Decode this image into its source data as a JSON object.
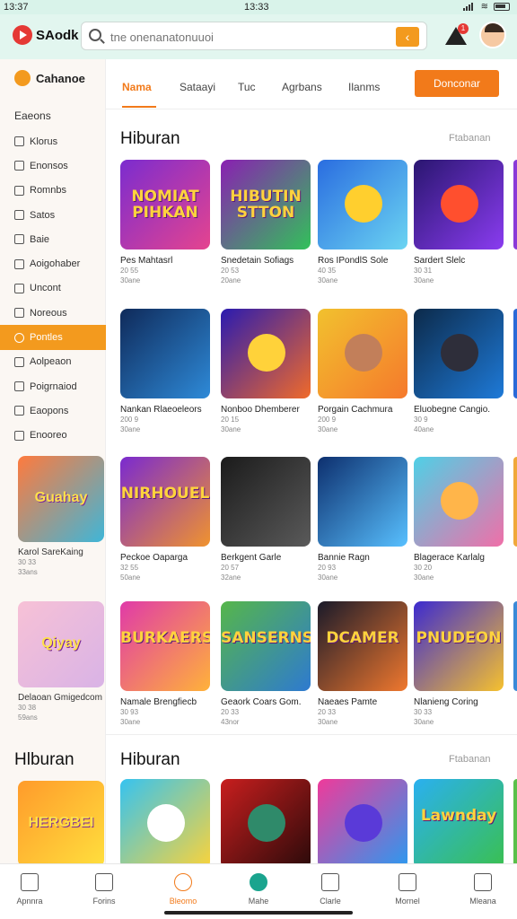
{
  "status": {
    "left_time": "13:37",
    "center_time": "13:33"
  },
  "header": {
    "brand": "SAodk",
    "search_placeholder": "tne onenanatonuuoi",
    "notification_count": "1"
  },
  "sidebar": {
    "brand": "Cahanoe",
    "heading": "Eaeons",
    "items": [
      {
        "label": "Klorus",
        "icon": "pencil-icon"
      },
      {
        "label": "Enonsos",
        "icon": "square-icon"
      },
      {
        "label": "Romnbs",
        "icon": "edit-icon"
      },
      {
        "label": "Satos",
        "icon": "edit-icon"
      },
      {
        "label": "Baie",
        "icon": "document-icon"
      },
      {
        "label": "Aoigohaber",
        "icon": "search-icon"
      },
      {
        "label": "Uncont",
        "icon": "document-icon"
      },
      {
        "label": "Noreous",
        "icon": "document-icon"
      },
      {
        "label": "Pontles",
        "icon": "heart-icon",
        "active": true
      },
      {
        "label": "Aolpeaon",
        "icon": "bulb-icon"
      },
      {
        "label": "Poigrnaiod",
        "icon": "edit-icon"
      },
      {
        "label": "Eaopons",
        "icon": "chart-icon"
      },
      {
        "label": "Enooreo",
        "icon": "grid-icon"
      }
    ],
    "cards": [
      {
        "name": "Karol SareKaing",
        "meta1": "30 33",
        "meta2": "33ans",
        "colors": [
          "#ff7a3d",
          "#3fb6d8"
        ],
        "text": "Guahay"
      },
      {
        "name": "Delaoan Gmigedcom",
        "meta1": "30 38",
        "meta2": "59ans",
        "colors": [
          "#f7c1d6",
          "#d9b3e6"
        ],
        "text": "Qiyay"
      },
      {
        "name": "",
        "meta1": "",
        "meta2": "",
        "colors": [
          "#ff9b2b",
          "#ffdf3d"
        ],
        "text": "HERGBEI"
      }
    ],
    "section_title": "Hlburan"
  },
  "tabs": [
    "Nama",
    "Sataayi",
    "Tuc",
    "Agrbans",
    "Ilanms"
  ],
  "cta": "Donconar",
  "section1": {
    "title": "Hiburan",
    "link": "Ftabanan"
  },
  "section2": {
    "title": "Hiburan",
    "link": "Ftabanan"
  },
  "games": [
    {
      "name": "Pes Mahtasrl",
      "meta1": "20 55",
      "meta2": "30ane",
      "text": "NOMIAT PIHKAN",
      "colors": [
        "#7b2ccf",
        "#e5448f"
      ],
      "face": ""
    },
    {
      "name": "Snedetain Sofiags",
      "meta1": "20 53",
      "meta2": "20ane",
      "text": "HIBUTIN STTON",
      "colors": [
        "#8a1fb2",
        "#32c15a"
      ],
      "face": ""
    },
    {
      "name": "Ros IPondlS Sole",
      "meta1": "40 35",
      "meta2": "30ane",
      "text": "",
      "colors": [
        "#2a6de0",
        "#6bd4f2"
      ],
      "face": "#ffcf2e"
    },
    {
      "name": "Sardert Slelc",
      "meta1": "30 31",
      "meta2": "30ane",
      "text": "",
      "colors": [
        "#2a1670",
        "#8a3cf0"
      ],
      "face": "#ff4f2e"
    },
    {
      "name": "Nankan Rlaeoeleors",
      "meta1": "200 9",
      "meta2": "30ane",
      "text": "",
      "colors": [
        "#0f2a5a",
        "#2e8ad8"
      ],
      "face": ""
    },
    {
      "name": "Nonboo Dhemberer",
      "meta1": "20 15",
      "meta2": "30ane",
      "text": "",
      "colors": [
        "#2a1bb0",
        "#f06a2a"
      ],
      "face": "#ffd23a"
    },
    {
      "name": "Porgain Cachmura",
      "meta1": "200 9",
      "meta2": "30ane",
      "text": "",
      "colors": [
        "#f2c12e",
        "#f5792c"
      ],
      "face": "#c27f5a"
    },
    {
      "name": "Eluobegne Cangio.",
      "meta1": "30 9",
      "meta2": "40ane",
      "text": "",
      "colors": [
        "#0c2a4a",
        "#1e7ad8"
      ],
      "face": "#2e2e3a"
    },
    {
      "name": "Peckoe Oaparga",
      "meta1": "32 55",
      "meta2": "50ane",
      "text": "NIRHOUEL",
      "colors": [
        "#7a2ad0",
        "#f0932e"
      ],
      "face": ""
    },
    {
      "name": "Berkgent Garle",
      "meta1": "20 57",
      "meta2": "32ane",
      "text": "",
      "colors": [
        "#1b1b1b",
        "#5a5a5a"
      ],
      "face": ""
    },
    {
      "name": "Bannie Ragn",
      "meta1": "20 93",
      "meta2": "30ane",
      "text": "",
      "colors": [
        "#0d2f6e",
        "#58c0ff"
      ],
      "face": ""
    },
    {
      "name": "Blagerace Karlalg",
      "meta1": "30 20",
      "meta2": "30ane",
      "text": "",
      "colors": [
        "#4fd0e6",
        "#f06fa8"
      ],
      "face": "#ffb54a"
    },
    {
      "name": "Namale Brengfiecb",
      "meta1": "30 93",
      "meta2": "30ane",
      "text": "BURKAERS",
      "colors": [
        "#e03aa8",
        "#ffb23a"
      ],
      "face": ""
    },
    {
      "name": "Geaork Coars Gom.",
      "meta1": "20 33",
      "meta2": "43nor",
      "text": "SANSERNS",
      "colors": [
        "#56b64a",
        "#2e7ad0"
      ],
      "face": ""
    },
    {
      "name": "Naeaes Pamte",
      "meta1": "20 33",
      "meta2": "30ane",
      "text": "DCAMER",
      "colors": [
        "#1a1a2a",
        "#f0782e"
      ],
      "face": ""
    },
    {
      "name": "Nlanieng Coring",
      "meta1": "30 33",
      "meta2": "30ane",
      "text": "PNUDEON",
      "colors": [
        "#3c2ad0",
        "#f6c12e"
      ],
      "face": ""
    },
    {
      "name": "",
      "meta1": "",
      "meta2": "",
      "text": "",
      "colors": [
        "#36c3f0",
        "#fbd33a"
      ],
      "face": "#ffffff"
    },
    {
      "name": "",
      "meta1": "",
      "meta2": "",
      "text": "",
      "colors": [
        "#c81e1e",
        "#2a0a0a"
      ],
      "face": "#2f8a6a"
    },
    {
      "name": "",
      "meta1": "",
      "meta2": "",
      "text": "",
      "colors": [
        "#f03a9a",
        "#2a9af0"
      ],
      "face": "#5a3ad8"
    },
    {
      "name": "",
      "meta1": "",
      "meta2": "",
      "text": "Lawnday",
      "colors": [
        "#2ab0f0",
        "#3ac050"
      ],
      "face": ""
    }
  ],
  "bottom_nav": [
    {
      "label": "Apnnra",
      "icon": "home-icon"
    },
    {
      "label": "Forins",
      "icon": "list-icon"
    },
    {
      "label": "Bleomo",
      "icon": "search-icon",
      "active": true
    },
    {
      "label": "Mahe",
      "icon": "shield-icon",
      "mid": true
    },
    {
      "label": "Clarle",
      "icon": "message-icon"
    },
    {
      "label": "Mornel",
      "icon": "person-icon"
    },
    {
      "label": "Mleana",
      "icon": "menu-icon"
    }
  ]
}
